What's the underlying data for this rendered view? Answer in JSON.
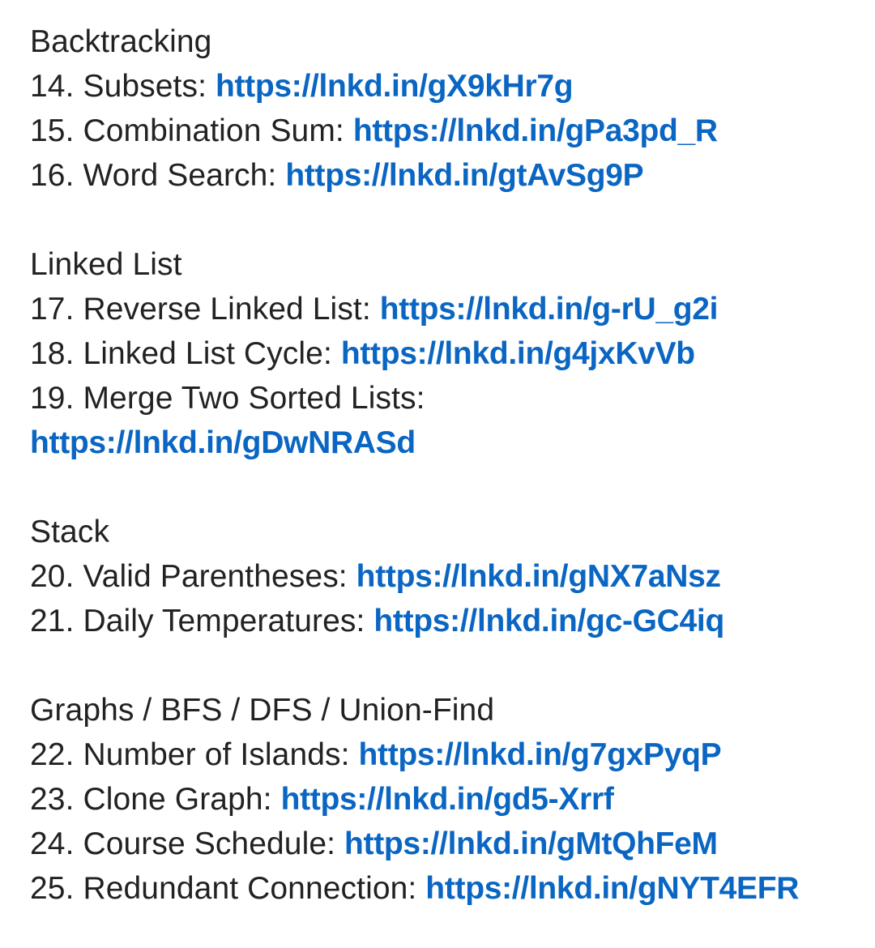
{
  "sections": [
    {
      "heading": "Backtracking",
      "items": [
        {
          "label": "14. Subsets:",
          "url": "https://lnkd.in/gX9kHr7g"
        },
        {
          "label": "15. Combination Sum:",
          "url": "https://lnkd.in/gPa3pd_R"
        },
        {
          "label": "16. Word Search:",
          "url": "https://lnkd.in/gtAvSg9P"
        }
      ]
    },
    {
      "heading": "Linked List",
      "items": [
        {
          "label": "17. Reverse Linked List:",
          "url": "https://lnkd.in/g-rU_g2i"
        },
        {
          "label": "18. Linked List Cycle:",
          "url": "https://lnkd.in/g4jxKvVb"
        },
        {
          "label": "19. Merge Two Sorted Lists:",
          "url": "https://lnkd.in/gDwNRASd"
        }
      ]
    },
    {
      "heading": "Stack",
      "items": [
        {
          "label": "20. Valid Parentheses:",
          "url": "https://lnkd.in/gNX7aNsz"
        },
        {
          "label": "21. Daily Temperatures:",
          "url": "https://lnkd.in/gc-GC4iq"
        }
      ]
    },
    {
      "heading": "Graphs / BFS / DFS / Union-Find",
      "items": [
        {
          "label": "22. Number of Islands:",
          "url": "https://lnkd.in/g7gxPyqP"
        },
        {
          "label": "23. Clone Graph:",
          "url": "https://lnkd.in/gd5-Xrrf"
        },
        {
          "label": "24. Course Schedule:",
          "url": "https://lnkd.in/gMtQhFeM"
        },
        {
          "label": "25. Redundant Connection:",
          "url": "https://lnkd.in/gNYT4EFR"
        }
      ]
    }
  ],
  "colors": {
    "text": "#222222",
    "link": "#0a66c2",
    "background": "#ffffff"
  }
}
